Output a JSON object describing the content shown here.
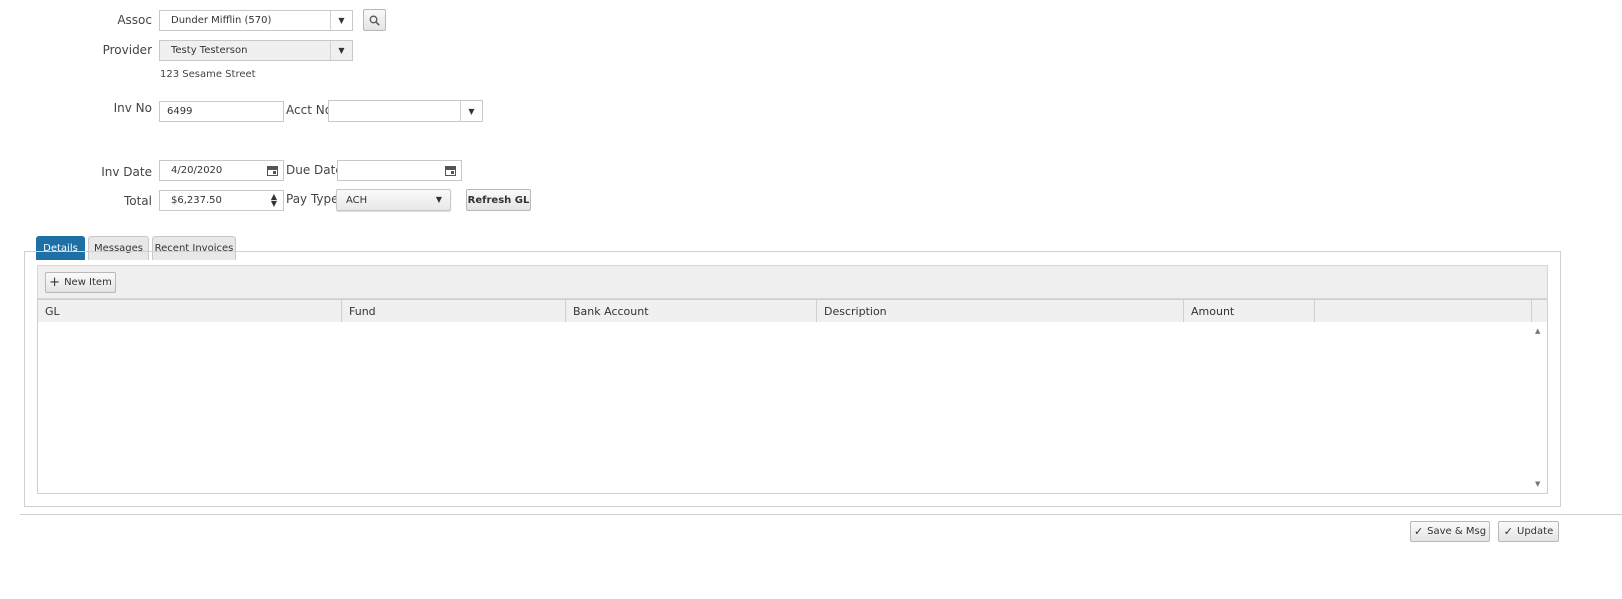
{
  "form": {
    "assoc_label": "Assoc",
    "assoc_value": "Dunder Mifflin (570)",
    "provider_label": "Provider",
    "provider_value": "Testy Testerson",
    "provider_address": "123 Sesame Street",
    "inv_no_label": "Inv No",
    "inv_no_value": "6499",
    "acct_no_label": "Acct No",
    "acct_no_value": "",
    "inv_date_label": "Inv Date",
    "inv_date_value": "4/20/2020",
    "due_date_label": "Due Date",
    "due_date_value": "",
    "total_label": "Total",
    "total_value": "$6,237.50",
    "pay_type_label": "Pay Type",
    "pay_type_value": "ACH",
    "refresh_gl_label": "Refresh GL"
  },
  "tabs": [
    {
      "label": "Details",
      "active": true
    },
    {
      "label": "Messages",
      "active": false
    },
    {
      "label": "Recent Invoices",
      "active": false
    }
  ],
  "grid": {
    "new_item_label": "New Item",
    "columns": [
      "GL",
      "Fund",
      "Bank Account",
      "Description",
      "Amount",
      ""
    ],
    "rows": []
  },
  "footer": {
    "save_msg_label": "Save & Msg",
    "update_label": "Update"
  },
  "icons": {
    "search": "search-icon",
    "calendar": "calendar-icon",
    "dropdown": "chevron-down-icon",
    "plus": "plus-icon",
    "check": "check-icon"
  },
  "colors": {
    "active_tab": "#1e6fa5",
    "panel_bg": "#efefef",
    "border": "#c8c8c8"
  }
}
